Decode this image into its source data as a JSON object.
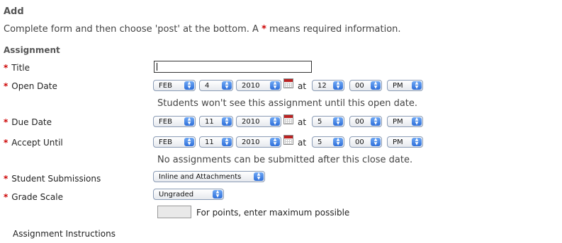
{
  "header": {
    "title": "Add",
    "instructions_pre": "Complete form and then choose 'post' at the bottom. A",
    "required_star": "*",
    "instructions_post": "means required information."
  },
  "section": {
    "title": "Assignment"
  },
  "fields": {
    "title": {
      "label": "Title",
      "value": ""
    },
    "open_date": {
      "label": "Open Date",
      "month": "FEB",
      "day": "4",
      "year": "2010",
      "at": "at",
      "hour": "12",
      "minute": "00",
      "ampm": "PM",
      "note": "Students won't see this assignment until this open date."
    },
    "due_date": {
      "label": "Due Date",
      "month": "FEB",
      "day": "11",
      "year": "2010",
      "at": "at",
      "hour": "5",
      "minute": "00",
      "ampm": "PM"
    },
    "accept_until": {
      "label": "Accept Until",
      "month": "FEB",
      "day": "11",
      "year": "2010",
      "at": "at",
      "hour": "5",
      "minute": "00",
      "ampm": "PM",
      "note": "No assignments can be submitted after this close date."
    },
    "student_submissions": {
      "label": "Student Submissions",
      "value": "Inline and Attachments"
    },
    "grade_scale": {
      "label": "Grade Scale",
      "value": "Ungraded"
    },
    "points": {
      "value": "",
      "hint": "For points, enter maximum possible"
    },
    "assignment_instructions": {
      "label": "Assignment Instructions"
    }
  },
  "icons": {
    "calendar": "calendar-icon",
    "select_arrow": "select-arrows-icon"
  },
  "colors": {
    "required": "#cc0000",
    "select_arrow": "#3a7be0"
  }
}
